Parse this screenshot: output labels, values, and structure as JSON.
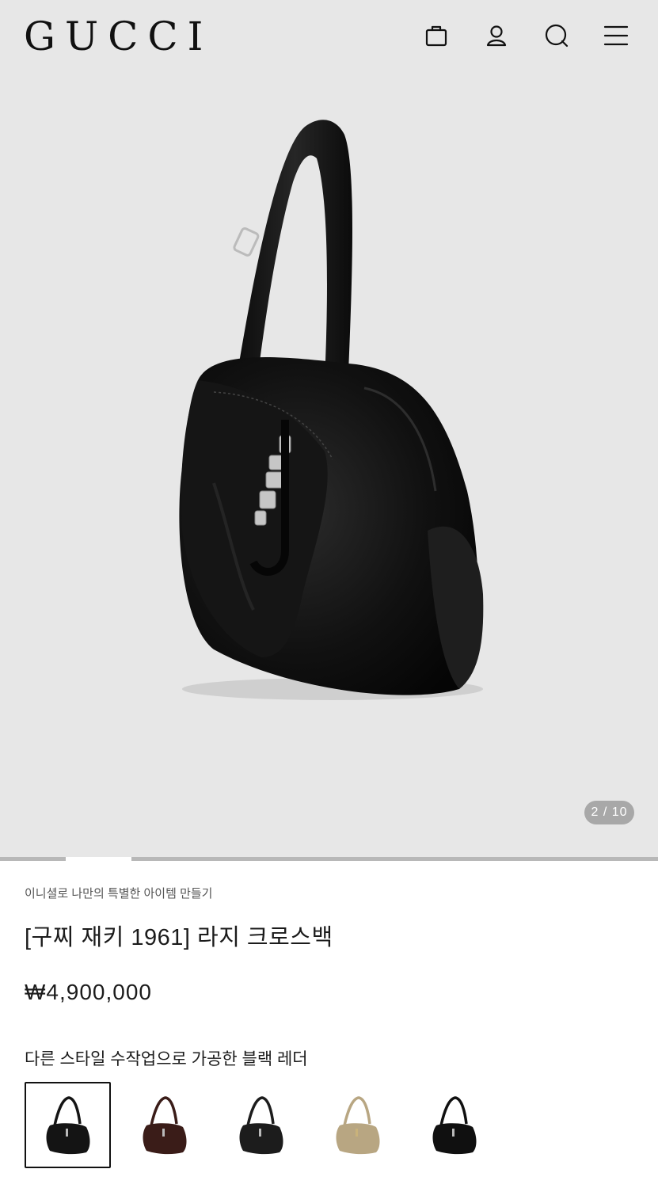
{
  "header": {
    "logo": "GUCCI",
    "icons": [
      "shopping-bag-icon",
      "account-icon",
      "search-icon",
      "menu-icon"
    ]
  },
  "gallery": {
    "counter": "2 / 10",
    "current": 2,
    "total": 10
  },
  "product": {
    "subtitle": "이니셜로 나만의 특별한 아이템 만들기",
    "title": "[구찌 재키 1961] 라지 크로스백",
    "price": "₩4,900,000",
    "description": "다른 스타일 수작업으로 가공한 블랙 레더"
  },
  "variants": [
    {
      "name": "black-leather",
      "color": "#141414",
      "hardware": "#b9b9b9",
      "selected": true
    },
    {
      "name": "dark-brown-leather",
      "color": "#3a1c18",
      "hardware": "#b9b9b9",
      "selected": false
    },
    {
      "name": "black-leather-2",
      "color": "#1c1c1c",
      "hardware": "#b9b9b9",
      "selected": false
    },
    {
      "name": "beige-gg-canvas",
      "color": "#b8a682",
      "hardware": "#c9b27a",
      "selected": false
    },
    {
      "name": "black-leather-3",
      "color": "#101010",
      "hardware": "#b9b9b9",
      "selected": false
    }
  ],
  "colors": {
    "background": "#e7e7e7",
    "text": "#1b1b1b",
    "counter_bg": "#a8a8a8"
  }
}
